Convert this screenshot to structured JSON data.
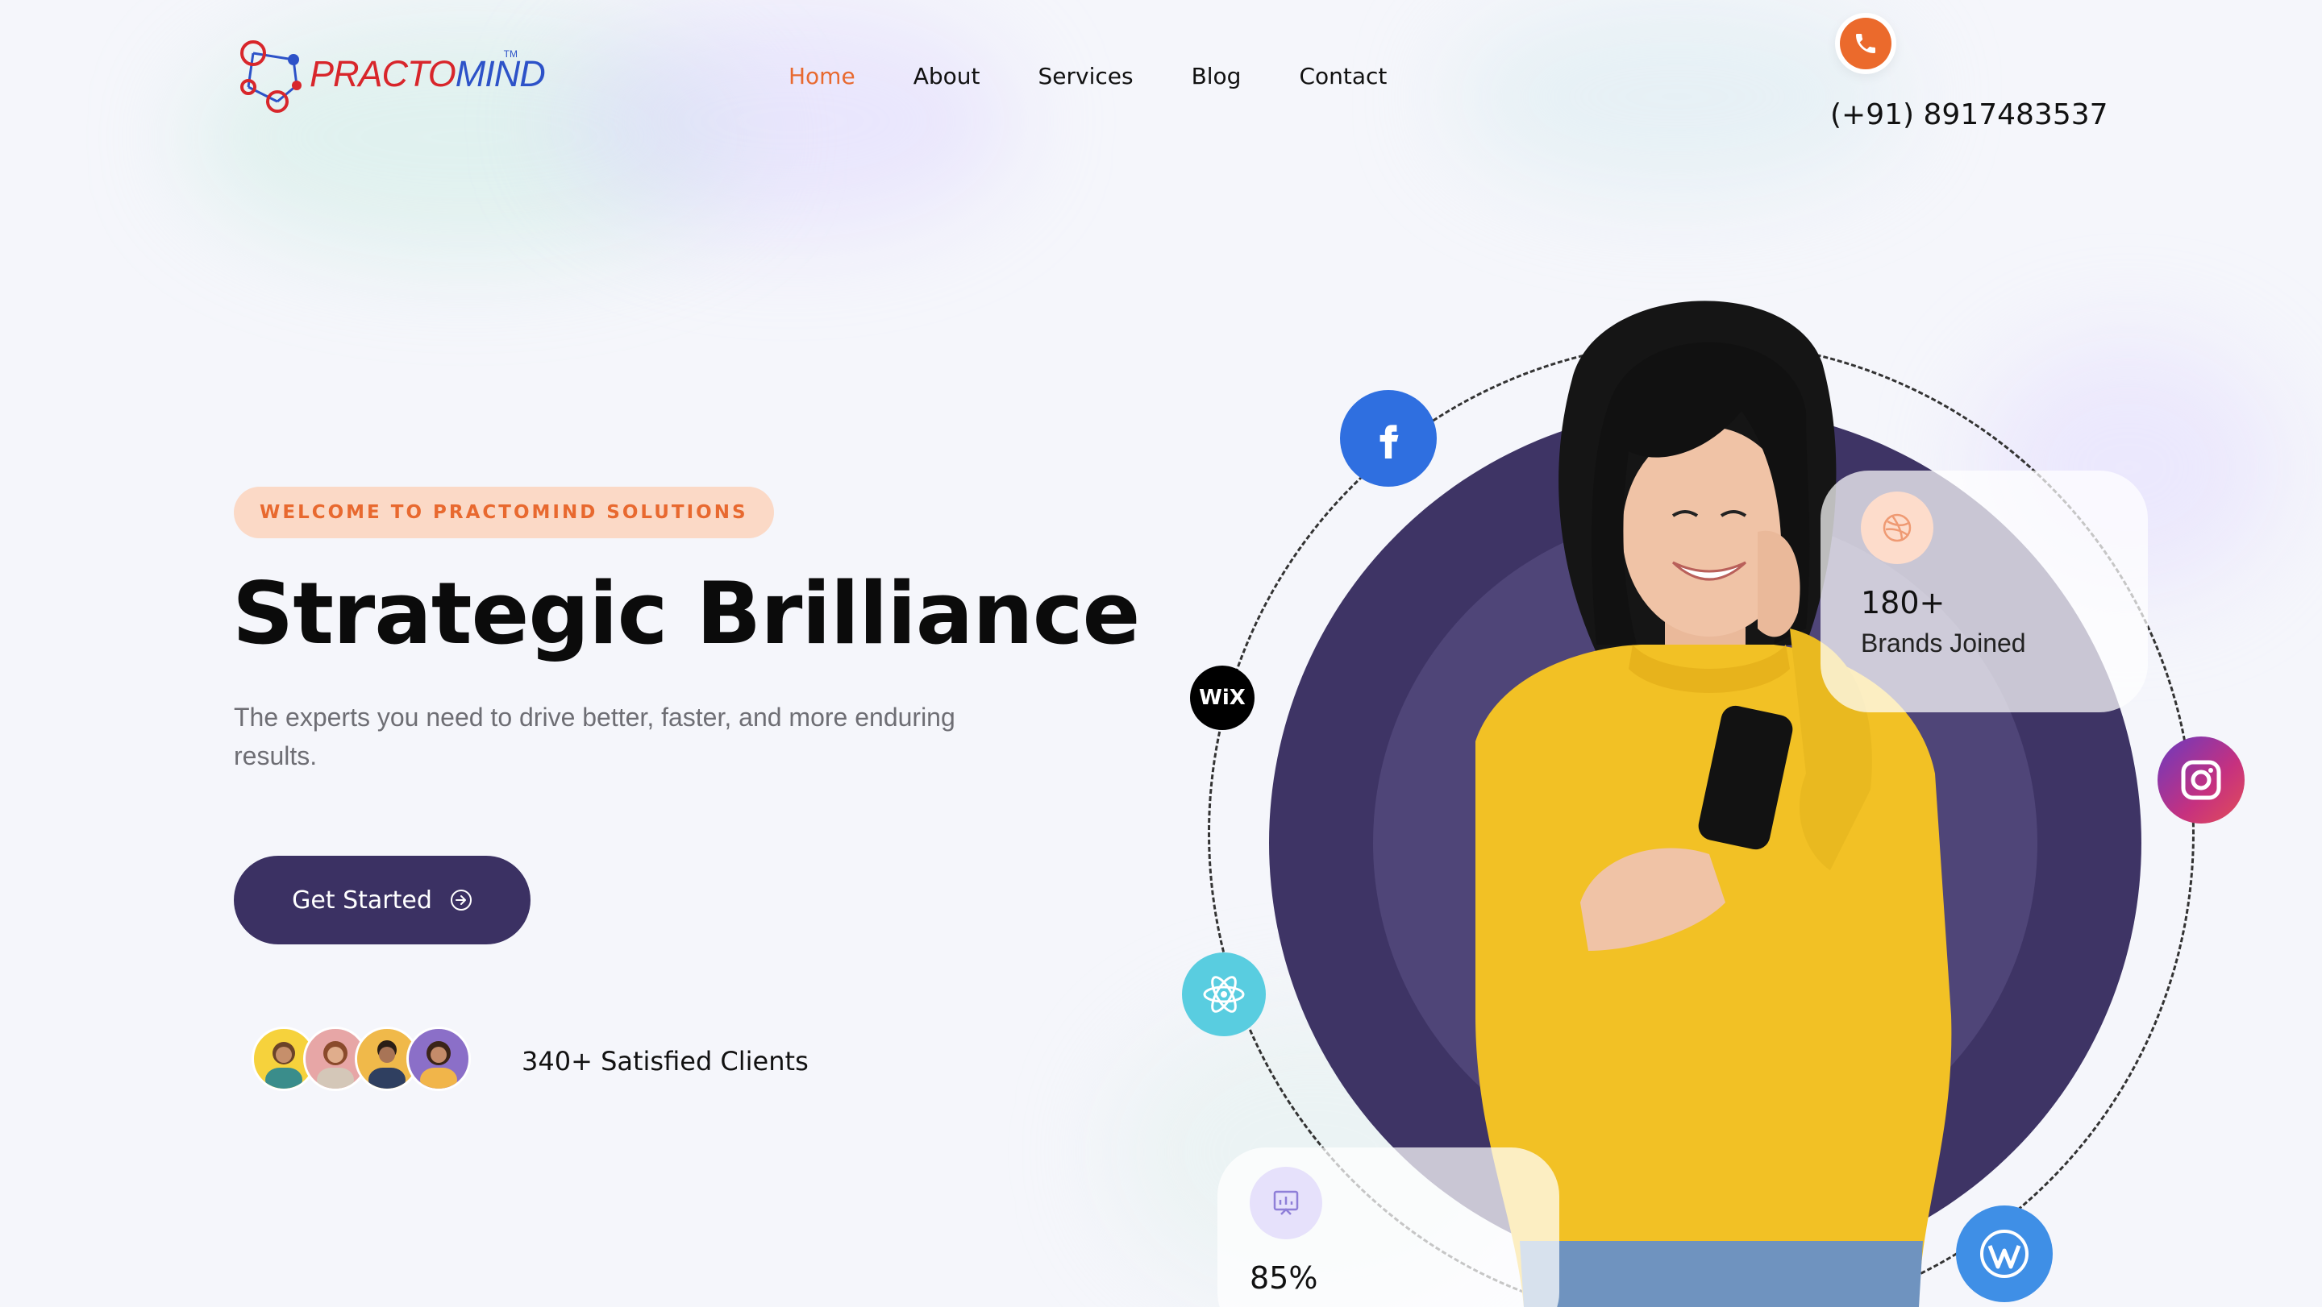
{
  "header": {
    "logo": {
      "text_part1": "PRACTO",
      "text_part2": "MIND",
      "trademark": "TM"
    },
    "nav": [
      {
        "label": "Home",
        "active": true
      },
      {
        "label": "About",
        "active": false
      },
      {
        "label": "Services",
        "active": false
      },
      {
        "label": "Blog",
        "active": false
      },
      {
        "label": "Contact",
        "active": false
      }
    ],
    "phone": {
      "icon": "phone-icon",
      "number": "(+91) 8917483537"
    }
  },
  "hero": {
    "badge": "WELCOME TO PRACTOMIND SOLUTIONS",
    "title": "Strategic Brilliance",
    "subtitle": "The experts you need to drive better, faster, and more enduring results.",
    "cta": {
      "label": "Get Started",
      "icon": "arrow-circle-right-icon"
    },
    "clients": {
      "text": "340+ Satisfied Clients",
      "avatar_count": 4
    }
  },
  "stats": {
    "brands": {
      "value": "180+",
      "label": "Brands Joined",
      "icon": "dribbble-icon"
    },
    "percent": {
      "value": "85%",
      "icon": "presentation-chart-icon"
    }
  },
  "social_icons": [
    "facebook-icon",
    "wix-icon",
    "react-icon",
    "instagram-icon",
    "wordpress-icon"
  ],
  "wix_label": "WiX",
  "colors": {
    "accent": "#e8692f",
    "primary": "#3b3163",
    "badge_bg": "#fbd9c6",
    "background": "#f5f6fb"
  }
}
